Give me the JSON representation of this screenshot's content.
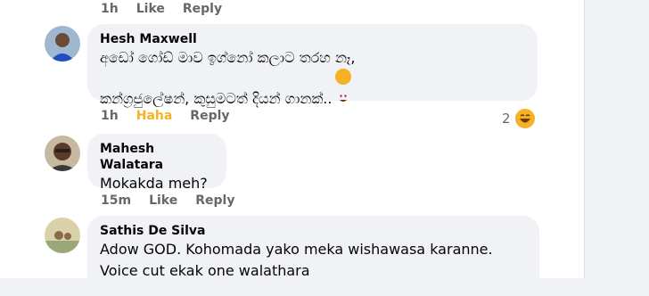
{
  "comments": [
    {
      "actions": {
        "time": "1h",
        "like": "Like",
        "reply": "Reply"
      }
    },
    {
      "author": "Hesh Maxwell",
      "text": "අඩෝ ගෝඩ් මාව ඉග්නෝ කලාට තරහ නෑ,\nකන්ග්‍රජුලේෂන්, කුසුමටත් දියන් ගානක්..",
      "emoji": "heart-eyes-emoji",
      "actions": {
        "time": "1h",
        "like": "Haha",
        "reply": "Reply"
      },
      "reaction_count": "2",
      "reaction_icon": "laughing-emoji"
    },
    {
      "author": "Mahesh Walatara",
      "text": "Mokakda meh?",
      "actions": {
        "time": "15m",
        "like": "Like",
        "reply": "Reply"
      }
    },
    {
      "author": "Sathis De Silva",
      "text": "Adow GOD. Kohomada yako meka wishawasa karanne.\nVoice cut ekak one walathara"
    }
  ],
  "colors": {
    "haha": "#f7b125",
    "muted": "#65676b",
    "bubble": "#f0f2f5"
  }
}
